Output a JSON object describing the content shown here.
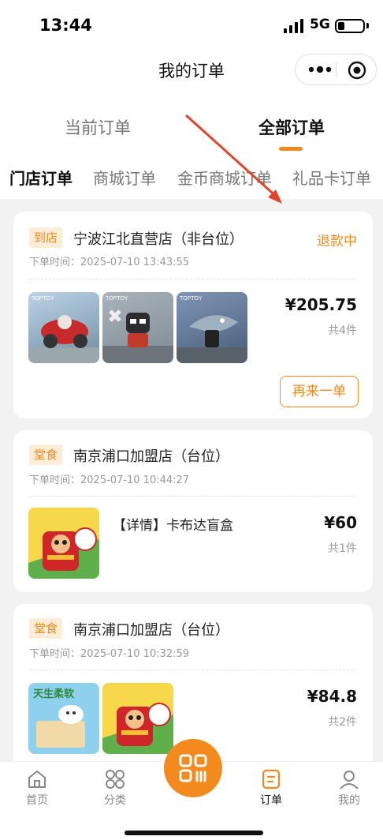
{
  "status_bar": {
    "time": "13:44",
    "network": "5G",
    "battery_percent": 25
  },
  "nav": {
    "title": "我的订单"
  },
  "main_tabs": [
    {
      "label": "当前订单",
      "active": false
    },
    {
      "label": "全部订单",
      "active": true
    }
  ],
  "sub_tabs": [
    {
      "label": "门店订单",
      "active": true
    },
    {
      "label": "商城订单",
      "active": false
    },
    {
      "label": "金币商城订单",
      "active": false
    },
    {
      "label": "礼品卡订单",
      "active": false
    }
  ],
  "orders": [
    {
      "tag": "到店",
      "store": "宁波江北直营店（非台位）",
      "status": "退款中",
      "time": "下单时间：2025-07-10 13:43:55",
      "price": "¥205.75",
      "qty": "共4件",
      "thumb_labels": [
        "TOPTOY",
        "TOPTOY",
        "TOPTOY"
      ],
      "action": "再来一单"
    },
    {
      "tag": "堂食",
      "store": "南京浦口加盟店（台位）",
      "time": "下单时间：2025-07-10 10:44:27",
      "product": "【详情】卡布达盲盒",
      "price": "¥60",
      "qty": "共1件"
    },
    {
      "tag": "堂食",
      "store": "南京浦口加盟店（台位）",
      "time": "下单时间：2025-07-10 10:32:59",
      "price": "¥84.8",
      "qty": "共2件",
      "thumb_text": "天生柔软"
    }
  ],
  "tabbar": [
    {
      "label": "首页",
      "icon": "home-icon"
    },
    {
      "label": "分类",
      "icon": "category-icon"
    },
    {
      "label": "",
      "icon": "scan-icon"
    },
    {
      "label": "订单",
      "icon": "order-icon",
      "active": true
    },
    {
      "label": "我的",
      "icon": "profile-icon"
    }
  ],
  "colors": {
    "accent": "#f08a1c",
    "tag_bg": "#fdecd6",
    "arrow": "#e0442c"
  }
}
